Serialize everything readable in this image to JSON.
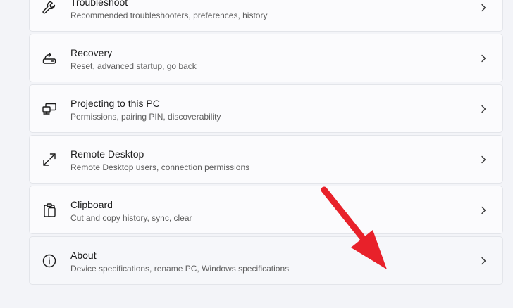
{
  "settings_items": [
    {
      "title": "Troubleshoot",
      "subtitle": "Recommended troubleshooters, preferences, history",
      "icon": "wrench-icon"
    },
    {
      "title": "Recovery",
      "subtitle": "Reset, advanced startup, go back",
      "icon": "recovery-icon"
    },
    {
      "title": "Projecting to this PC",
      "subtitle": "Permissions, pairing PIN, discoverability",
      "icon": "projecting-icon"
    },
    {
      "title": "Remote Desktop",
      "subtitle": "Remote Desktop users, connection permissions",
      "icon": "remote-desktop-icon"
    },
    {
      "title": "Clipboard",
      "subtitle": "Cut and copy history, sync, clear",
      "icon": "clipboard-icon"
    },
    {
      "title": "About",
      "subtitle": "Device specifications, rename PC, Windows specifications",
      "icon": "info-icon"
    }
  ],
  "colors": {
    "background": "#f3f4f8",
    "card": "#fbfbfd",
    "annotation_arrow": "#e8212a"
  }
}
